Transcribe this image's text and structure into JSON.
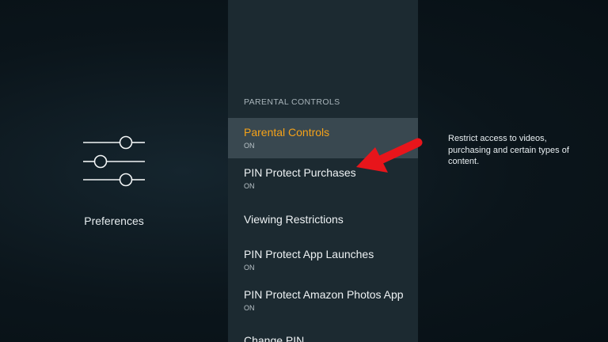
{
  "category": {
    "label": "Preferences",
    "icon": "sliders-icon"
  },
  "menu": {
    "header": "PARENTAL CONTROLS",
    "items": [
      {
        "label": "Parental Controls",
        "value": "ON",
        "selected": true
      },
      {
        "label": "PIN Protect Purchases",
        "value": "ON"
      },
      {
        "label": "Viewing Restrictions"
      },
      {
        "label": "PIN Protect App Launches",
        "value": "ON"
      },
      {
        "label": "PIN Protect Amazon Photos App",
        "value": "ON"
      },
      {
        "label": "Change PIN"
      }
    ]
  },
  "description": "Restrict access to videos, purchasing and certain types of content.",
  "colors": {
    "selected_label": "#f5a219",
    "selected_background": "#394850",
    "panel_background": "#1c2a31",
    "annotation_arrow": "#e8151b"
  }
}
